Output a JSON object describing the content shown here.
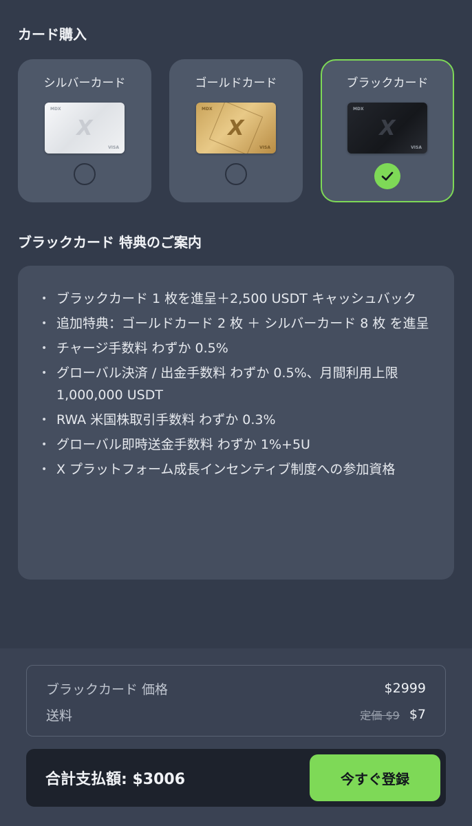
{
  "purchase": {
    "title": "カード購入",
    "cards": [
      {
        "name": "シルバーカード",
        "selected": false,
        "logo": "X",
        "brand": "MDX",
        "network": "VISA"
      },
      {
        "name": "ゴールドカード",
        "selected": false,
        "logo": "X",
        "brand": "MDX",
        "network": "VISA"
      },
      {
        "name": "ブラックカード",
        "selected": true,
        "logo": "X",
        "brand": "MDX",
        "network": "VISA"
      }
    ]
  },
  "benefits": {
    "title": "ブラックカード 特典のご案内",
    "items": [
      "ブラックカード 1 枚を進呈＋2,500 USDT キャッシュバック",
      "追加特典：ゴールドカード 2 枚 ＋ シルバーカード 8 枚 を進呈",
      "チャージ手数料 わずか 0.5%",
      "グローバル決済 / 出金手数料 わずか 0.5%、月間利用上限 1,000,000 USDT",
      "RWA 米国株取引手数料 わずか 0.3%",
      "グローバル即時送金手数料 わずか 1%+5U",
      "X プラットフォーム成長インセンティブ制度への参加資格"
    ]
  },
  "pricing": {
    "card_price_label": "ブラックカード 価格",
    "card_price_value": "$2999",
    "shipping_label": "送料",
    "shipping_original": "定価 $9",
    "shipping_value": "$7"
  },
  "total": {
    "label": "合計支払額: $3006",
    "button_label": "今すぐ登録"
  },
  "colors": {
    "accent": "#7ed957",
    "background": "#333b4b",
    "card_panel": "#4e5869"
  }
}
